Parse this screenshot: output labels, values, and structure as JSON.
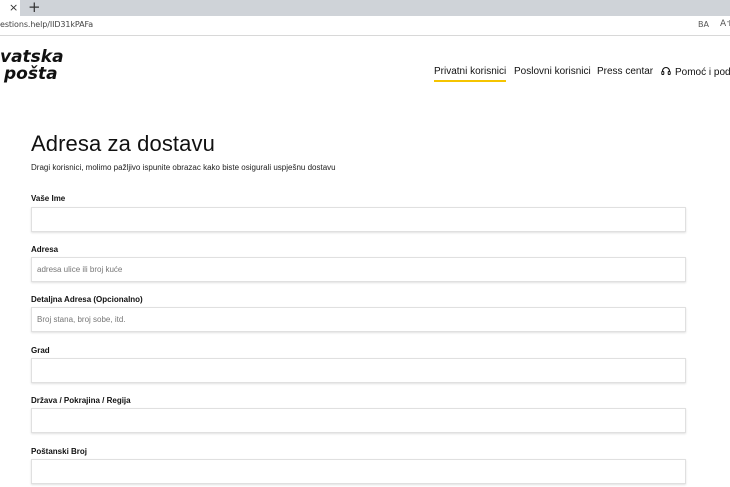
{
  "browser": {
    "tab_close": "×",
    "new_tab": "+",
    "url": "estions.help/IID31kPAFa",
    "reader_icon_text": "ꓐA",
    "font_icon_text": "A˦"
  },
  "logo": {
    "line1": "vatska",
    "line2": "pošta"
  },
  "nav": {
    "items": [
      {
        "label": "Privatni korisnici"
      },
      {
        "label": "Poslovni korisnici"
      },
      {
        "label": "Press centar"
      },
      {
        "label": "Pomoć i podrš"
      }
    ]
  },
  "form": {
    "title": "Adresa za dostavu",
    "subtitle": "Dragi korisnici, molimo pažljivo ispunite obrazac kako biste osigurali uspješnu dostavu",
    "fields": [
      {
        "label": "Vaše Ime",
        "placeholder": "",
        "value": ""
      },
      {
        "label": "Adresa",
        "placeholder": "adresa ulice ili broj kuće",
        "value": ""
      },
      {
        "label": "Detaljna Adresa (Opcionalno)",
        "placeholder": "Broj stana, broj sobe, itd.",
        "value": ""
      },
      {
        "label": "Grad",
        "placeholder": "",
        "value": ""
      },
      {
        "label": "Država / Pokrajina / Regija",
        "placeholder": "",
        "value": ""
      },
      {
        "label": "Poštanski Broj",
        "placeholder": "",
        "value": ""
      }
    ]
  },
  "colors": {
    "accent": "#f5c400",
    "tabbar": "#cfd3d8"
  }
}
